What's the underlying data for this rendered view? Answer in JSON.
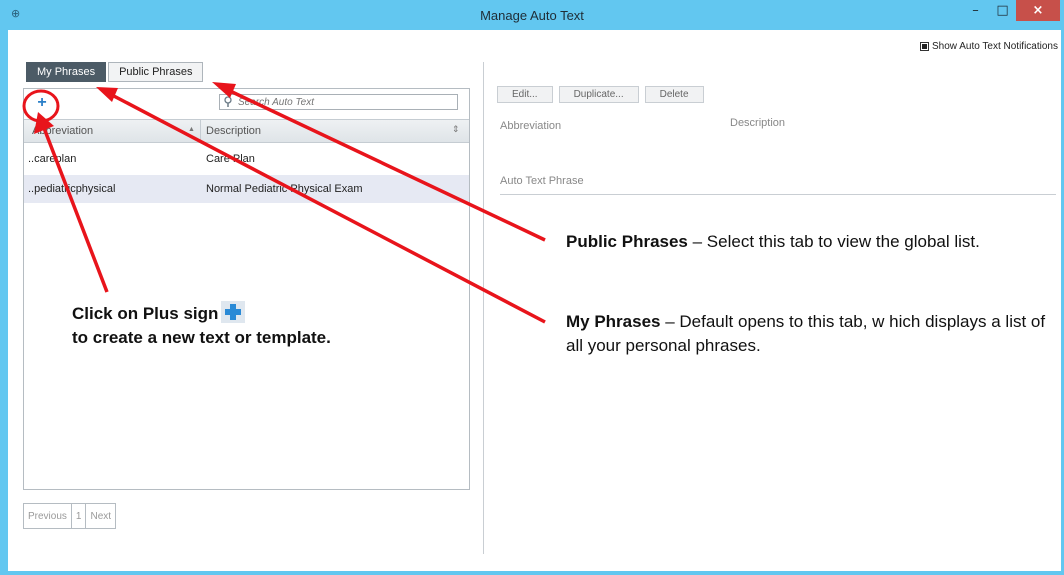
{
  "window": {
    "title": "Manage Auto Text",
    "minimize": "–",
    "maximize": "□",
    "close": "×"
  },
  "notifications": {
    "label": "Show Auto Text Notifications",
    "checked": true
  },
  "tabs": [
    {
      "label": "My Phrases",
      "active": true
    },
    {
      "label": "Public Phrases",
      "active": false
    }
  ],
  "list": {
    "search_placeholder": "Search Auto Text",
    "columns": [
      "Abbreviation",
      "Description"
    ],
    "rows": [
      {
        "abbreviation": "..careplan",
        "description": "Care Plan",
        "selected": false
      },
      {
        "abbreviation": "..pediatricphysical",
        "description": "Normal Pediatric Physical Exam",
        "selected": true
      }
    ]
  },
  "pager": {
    "previous": "Previous",
    "page": "1",
    "next": "Next"
  },
  "details": {
    "buttons": [
      "Edit...",
      "Duplicate...",
      "Delete"
    ],
    "abbreviation_label": "Abbreviation",
    "description_label": "Description",
    "phrase_label": "Auto Text Phrase"
  },
  "annotations": {
    "plus": {
      "line1": "Click on Plus sign",
      "line2": "to create a new text or template."
    },
    "public": {
      "title": "Public Phrases",
      "text": " – Select this tab to view the global list."
    },
    "my": {
      "title": "My Phrases",
      "text": " – Default opens to this tab, w hich displays a list of all your personal phrases."
    }
  },
  "colors": {
    "titlebar": "#62c7f0",
    "arrow": "#e8141b",
    "active_tab": "#4c5b66",
    "close_button": "#c7504a"
  }
}
